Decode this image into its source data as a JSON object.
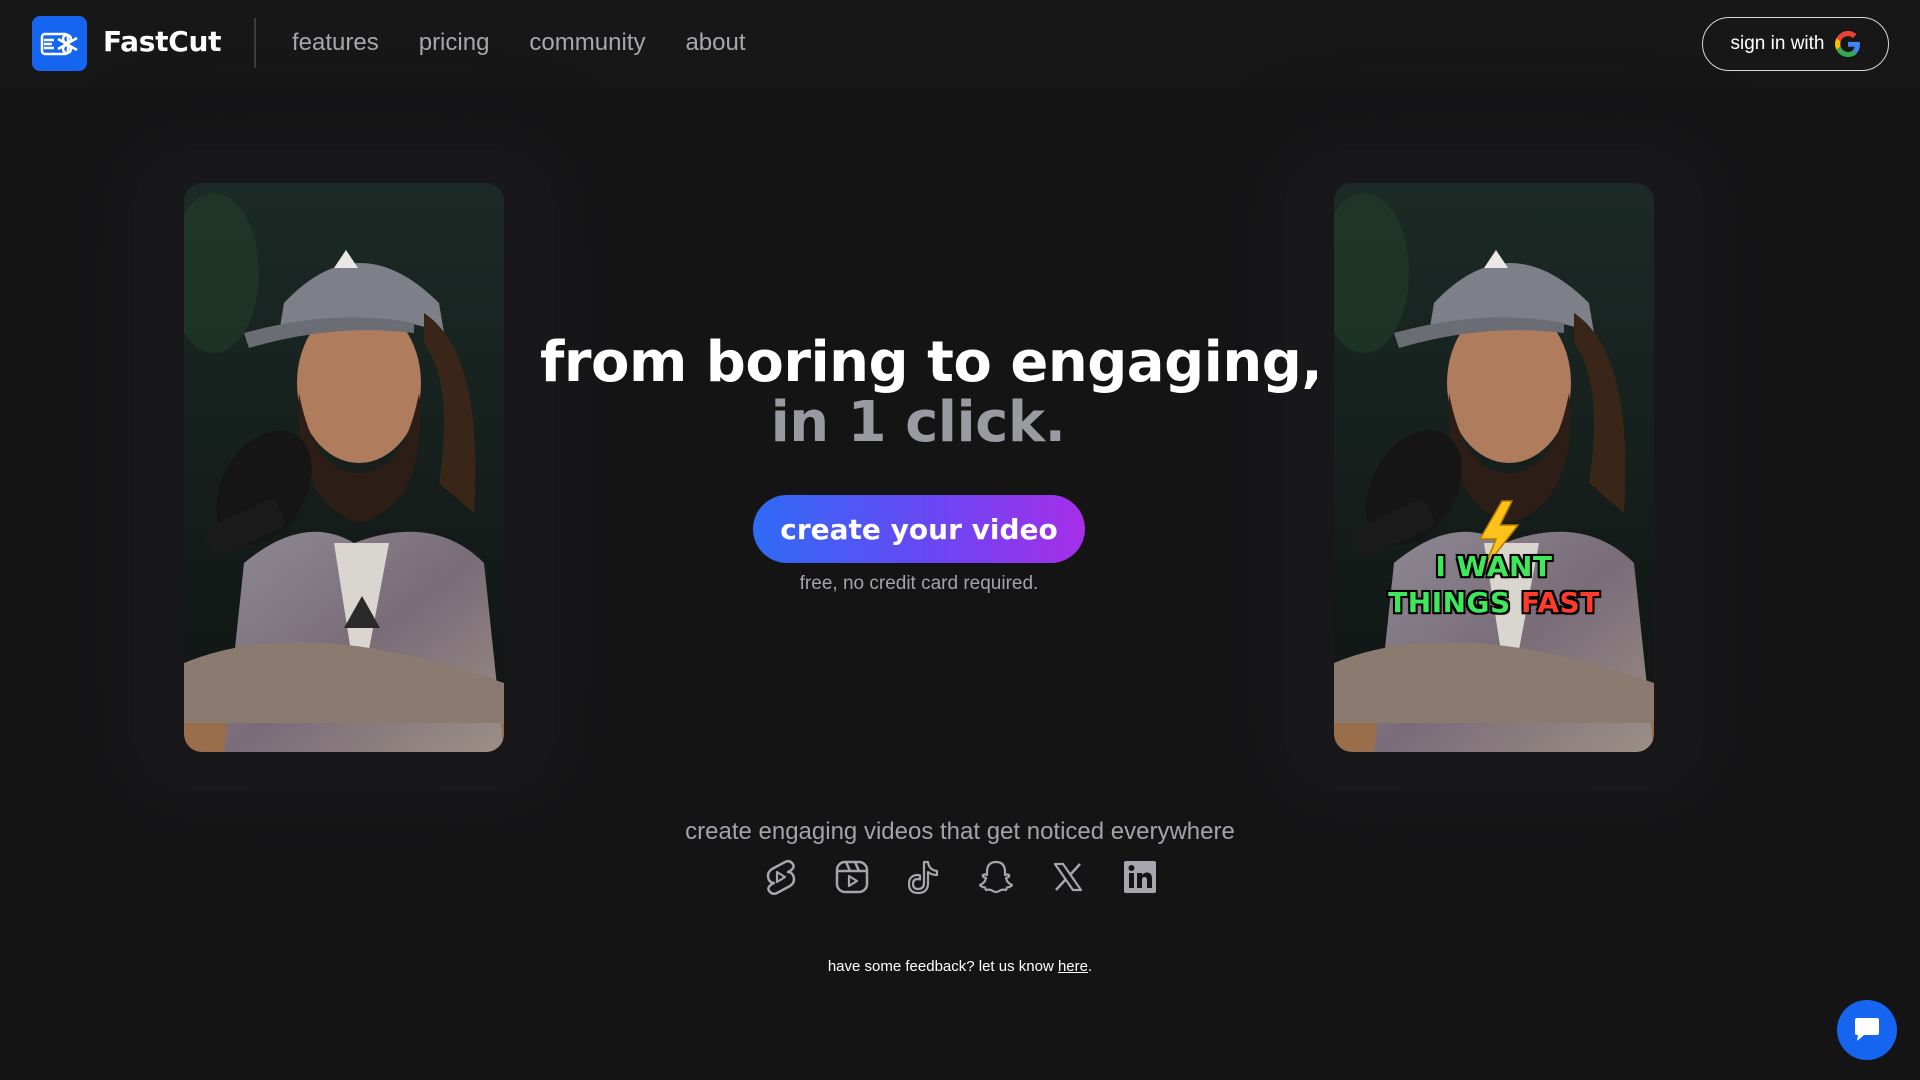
{
  "header": {
    "brand": "FastCut",
    "logo_icon": "scissors-icon",
    "nav": [
      "features",
      "pricing",
      "community",
      "about"
    ],
    "signin_label": "sign in with",
    "signin_icon": "google-icon"
  },
  "hero": {
    "line1": "from boring to engaging,",
    "line2": "in 1 click.",
    "cta_label": "create your video",
    "cta_sub": "free, no credit card required."
  },
  "videos": {
    "before": {
      "description_icon": "video-thumbnail"
    },
    "after": {
      "emoji_icon": "lightning-icon",
      "caption_line1": "I WANT",
      "caption_line2_a": "THINGS",
      "caption_line2_b": "FAST"
    }
  },
  "platforms": {
    "text": "create engaging videos that get noticed everywhere",
    "icons": [
      "youtube-shorts-icon",
      "instagram-reels-icon",
      "tiktok-icon",
      "snapchat-icon",
      "x-icon",
      "linkedin-icon"
    ]
  },
  "feedback": {
    "text": "have some feedback? let us know ",
    "link": "here",
    "suffix": "."
  },
  "colors": {
    "background": "#141415",
    "accent": "#1565f0",
    "cta_gradient_start": "#2f6bf5",
    "cta_gradient_end": "#a62ee8",
    "caption_green": "#3ee85a",
    "caption_red": "#ff3b2e"
  }
}
